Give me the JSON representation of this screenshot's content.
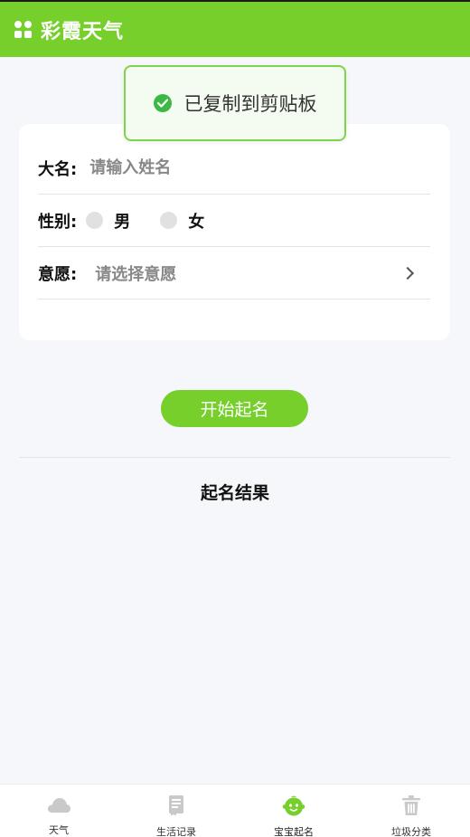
{
  "header": {
    "title": "彩霞天气",
    "icon": "grid-icon"
  },
  "toast": {
    "text": "已复制到剪贴板",
    "icon": "check-circle-icon"
  },
  "form": {
    "name_label": "大名:",
    "name_placeholder": "请输入姓名",
    "gender_label": "性别:",
    "gender_options": [
      "男",
      "女"
    ],
    "wish_label": "意愿:",
    "wish_placeholder": "请选择意愿"
  },
  "start_button_label": "开始起名",
  "result_title": "起名结果",
  "tabs": [
    {
      "label": "天气",
      "icon": "cloud-icon",
      "active": false
    },
    {
      "label": "生活记录",
      "icon": "notebook-icon",
      "active": false
    },
    {
      "label": "宝宝起名",
      "icon": "baby-face-icon",
      "active": true
    },
    {
      "label": "垃圾分类",
      "icon": "trash-icon",
      "active": false
    }
  ],
  "colors": {
    "accent": "#76cf2a",
    "toast_border": "#7fd34a",
    "check": "#3cb846",
    "inactive_icon": "#c9c9c9"
  }
}
